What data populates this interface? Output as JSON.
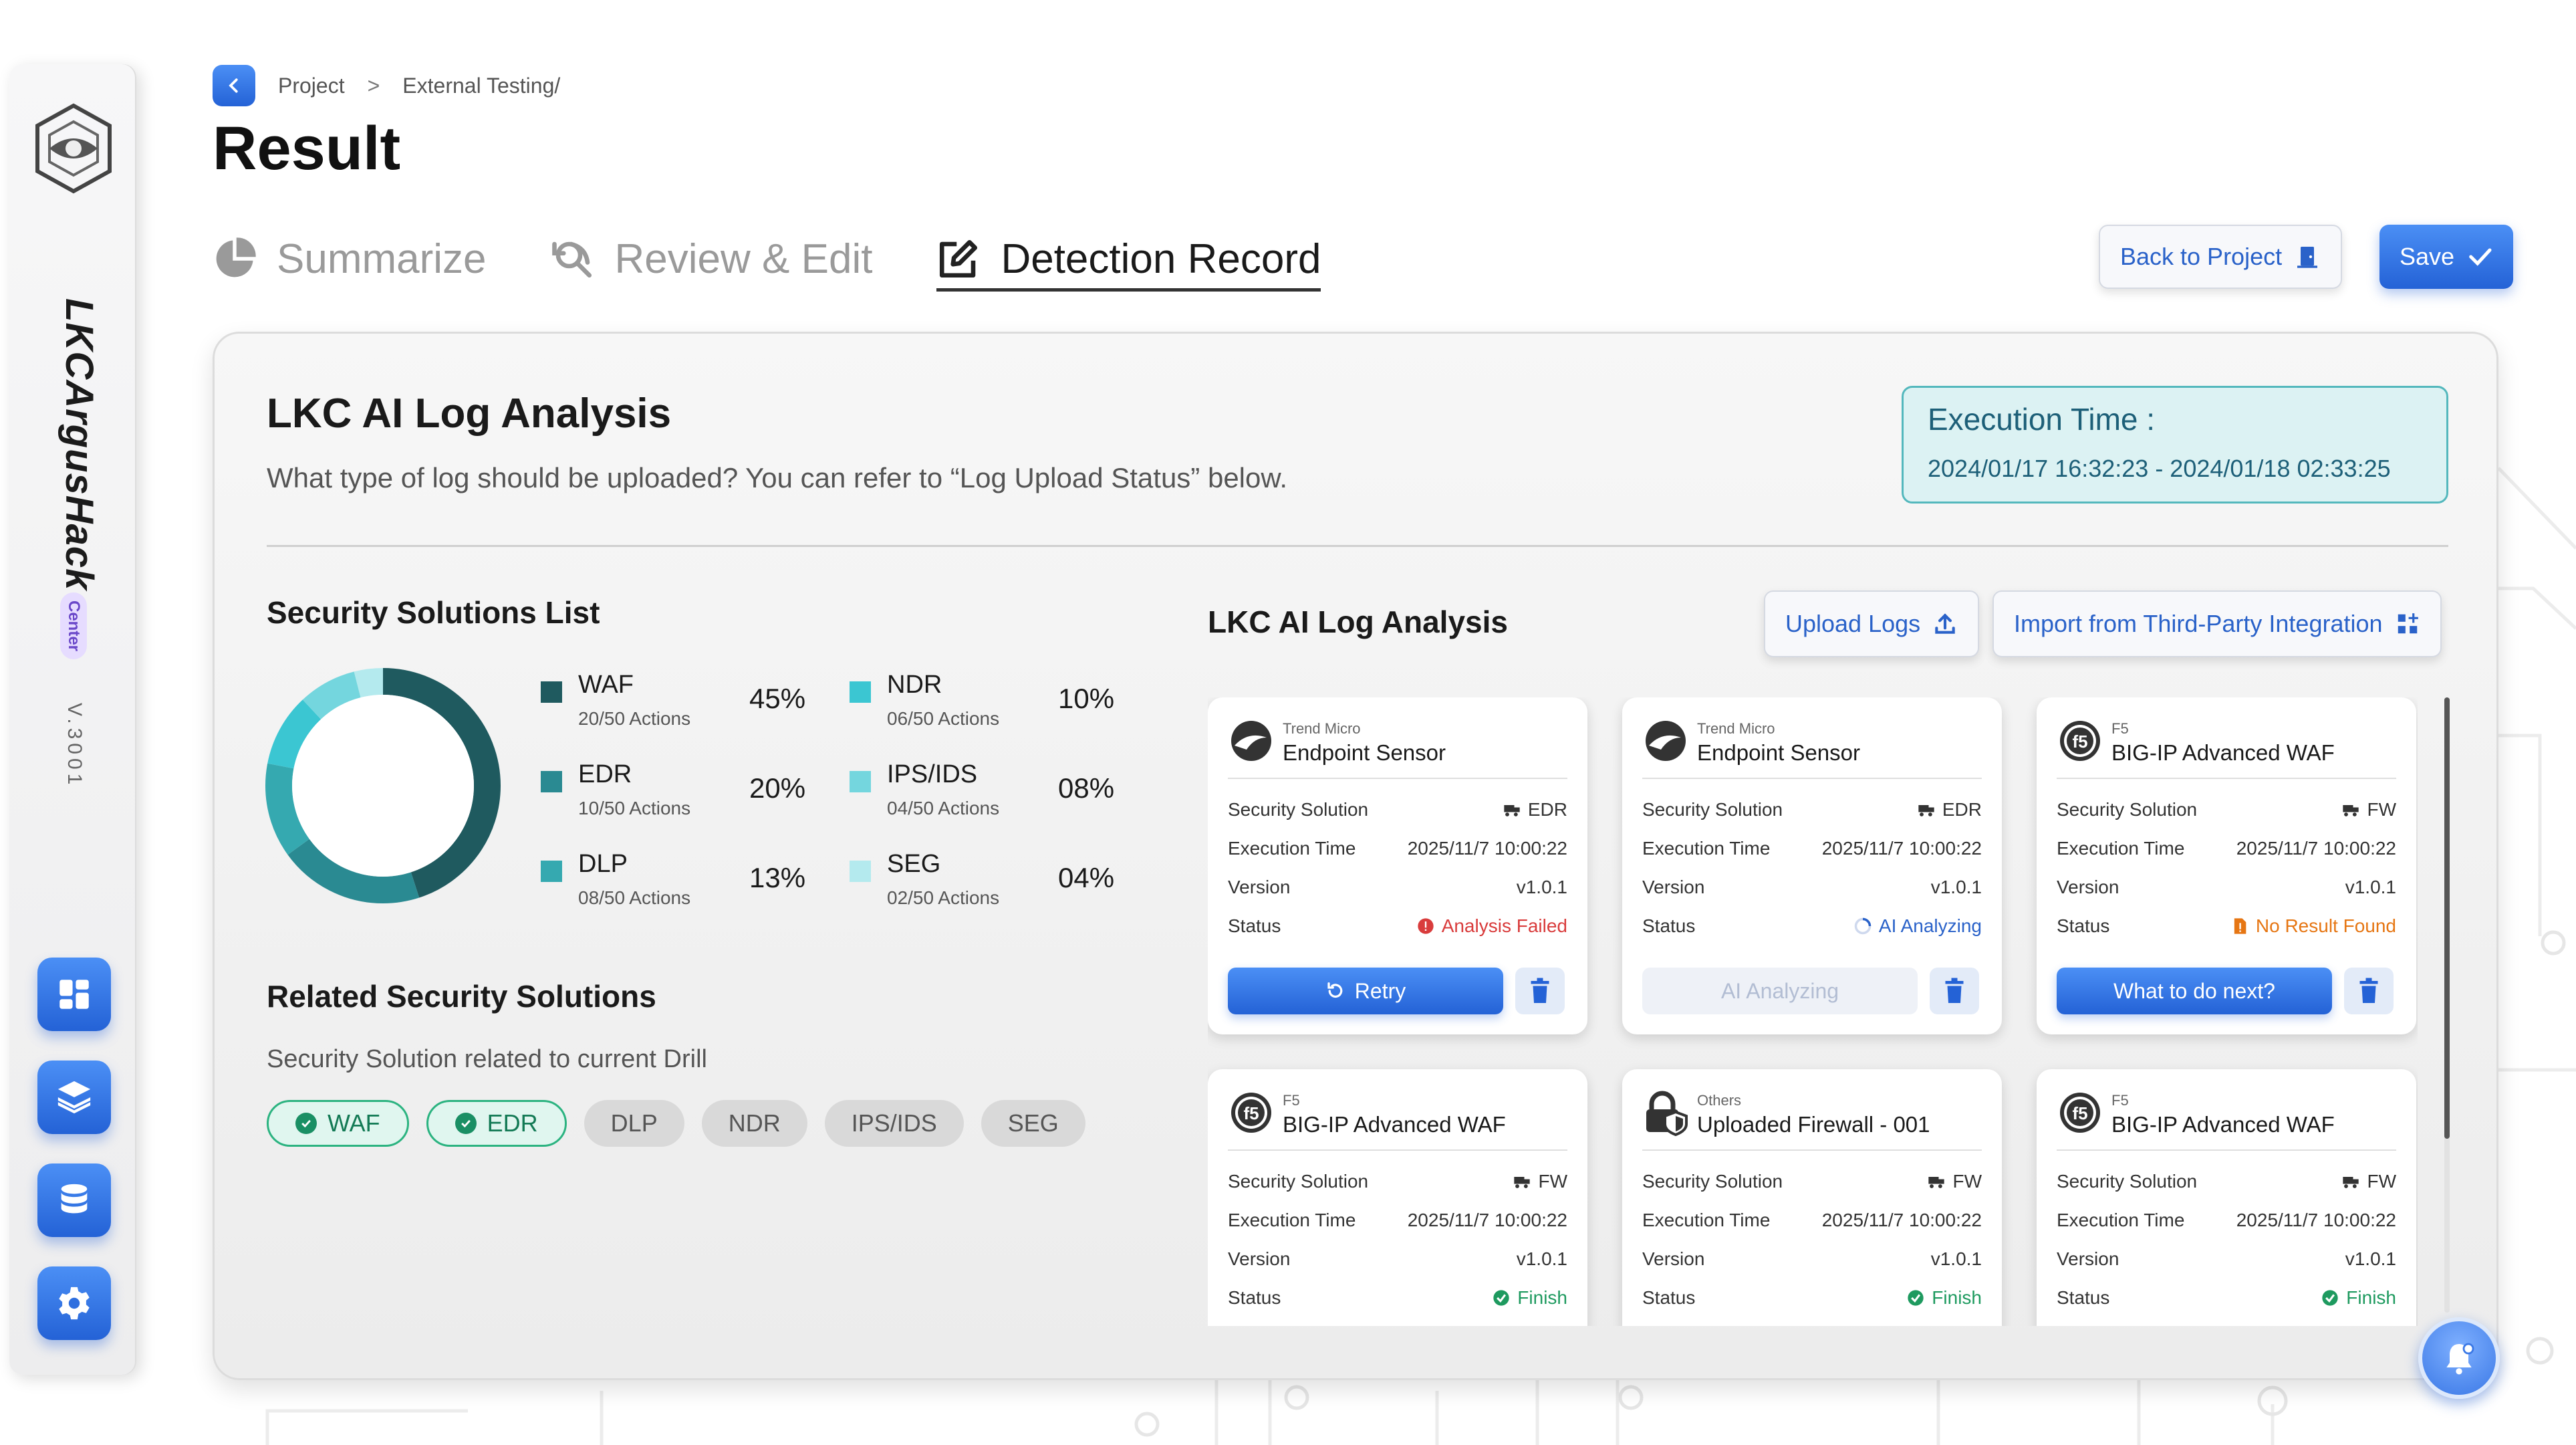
{
  "sidebar": {
    "brand": "LKCArgusHack",
    "badge": "Center",
    "version": "V.3001",
    "nav_icons": [
      "dashboard-icon",
      "layers-icon",
      "database-icon",
      "settings-icon"
    ]
  },
  "breadcrumb": {
    "items": [
      "Project",
      "External Testing/"
    ],
    "separator": ">"
  },
  "page": {
    "title": "Result"
  },
  "tabs": [
    {
      "label": "Summarize",
      "icon": "pie-chart-icon",
      "active": false
    },
    {
      "label": "Review & Edit",
      "icon": "search-refresh-icon",
      "active": false
    },
    {
      "label": "Detection Record",
      "icon": "edit-box-icon",
      "active": true
    }
  ],
  "actions": {
    "back_label": "Back to Project",
    "save_label": "Save"
  },
  "analysis": {
    "title": "LKC AI Log Analysis",
    "subtitle": "What type of log should be uploaded? You can refer to “Log Upload Status” below.",
    "execution_label": "Execution Time :",
    "execution_value": "2024/01/17 16:32:23 - 2024/01/18 02:33:25"
  },
  "solutions_list": {
    "title": "Security Solutions List",
    "items": [
      {
        "name": "WAF",
        "actions": "20/50 Actions",
        "pct": "45%",
        "color": "#1f5a5f"
      },
      {
        "name": "EDR",
        "actions": "10/50 Actions",
        "pct": "20%",
        "color": "#2a8a92"
      },
      {
        "name": "DLP",
        "actions": "08/50 Actions",
        "pct": "13%",
        "color": "#35a9b0"
      },
      {
        "name": "NDR",
        "actions": "06/50 Actions",
        "pct": "10%",
        "color": "#3bc6d2"
      },
      {
        "name": "IPS/IDS",
        "actions": "04/50 Actions",
        "pct": "08%",
        "color": "#74d6de"
      },
      {
        "name": "SEG",
        "actions": "02/50 Actions",
        "pct": "04%",
        "color": "#b4eaee"
      }
    ]
  },
  "related": {
    "title": "Related Security Solutions",
    "subtitle": "Security Solution related to current Drill",
    "chips": [
      {
        "label": "WAF",
        "selected": true
      },
      {
        "label": "EDR",
        "selected": true
      },
      {
        "label": "DLP",
        "selected": false
      },
      {
        "label": "NDR",
        "selected": false
      },
      {
        "label": "IPS/IDS",
        "selected": false
      },
      {
        "label": "SEG",
        "selected": false
      }
    ]
  },
  "log_panel": {
    "title": "LKC AI Log Analysis",
    "upload_label": "Upload Logs",
    "import_label": "Import from Third-Party Integration",
    "row_labels": {
      "solution": "Security Solution",
      "exec_time": "Execution Time",
      "version": "Version",
      "status": "Status"
    },
    "cards": [
      {
        "vendor": "Trend Micro",
        "name": "Endpoint Sensor",
        "icon": "trend-micro-logo-icon",
        "solution": "EDR",
        "exec_time": "2025/11/7 10:00:22",
        "version": "v1.0.1",
        "status": "Analysis Failed",
        "status_type": "fail",
        "action": "Retry",
        "action_enabled": true
      },
      {
        "vendor": "Trend Micro",
        "name": "Endpoint Sensor",
        "icon": "trend-micro-logo-icon",
        "solution": "EDR",
        "exec_time": "2025/11/7 10:00:22",
        "version": "v1.0.1",
        "status": "AI Analyzing",
        "status_type": "analyzing",
        "action": "AI Analyzing",
        "action_enabled": false
      },
      {
        "vendor": "F5",
        "name": "BIG-IP Advanced WAF",
        "icon": "f5-logo-icon",
        "solution": "FW",
        "exec_time": "2025/11/7 10:00:22",
        "version": "v1.0.1",
        "status": "No Result Found",
        "status_type": "none",
        "action": "What to do next?",
        "action_enabled": true
      },
      {
        "vendor": "F5",
        "name": "BIG-IP Advanced WAF",
        "icon": "f5-logo-icon",
        "solution": "FW",
        "exec_time": "2025/11/7 10:00:22",
        "version": "v1.0.1",
        "status": "Finish",
        "status_type": "finish",
        "action": "",
        "action_enabled": true
      },
      {
        "vendor": "Others",
        "name": "Uploaded Firewall - 001",
        "icon": "lock-shield-icon",
        "solution": "FW",
        "exec_time": "2025/11/7 10:00:22",
        "version": "v1.0.1",
        "status": "Finish",
        "status_type": "finish",
        "action": "",
        "action_enabled": true
      },
      {
        "vendor": "F5",
        "name": "BIG-IP Advanced WAF",
        "icon": "f5-logo-icon",
        "solution": "FW",
        "exec_time": "2025/11/7 10:00:22",
        "version": "v1.0.1",
        "status": "Finish",
        "status_type": "finish",
        "action": "",
        "action_enabled": true
      }
    ]
  }
}
